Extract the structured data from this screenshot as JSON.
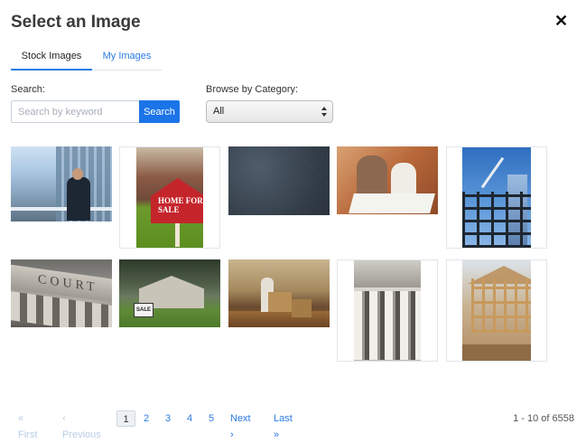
{
  "dialog": {
    "title": "Select an Image",
    "close_glyph": "✕"
  },
  "tabs": [
    {
      "label": "Stock Images",
      "active": true
    },
    {
      "label": "My Images",
      "active": false
    }
  ],
  "search": {
    "label": "Search:",
    "placeholder": "Search by keyword",
    "value": "",
    "button_label": "Search"
  },
  "category": {
    "label": "Browse by Category:",
    "selected": "All"
  },
  "images": [
    {
      "subject": "businessman-balcony"
    },
    {
      "subject": "home-for-sale-sign",
      "caption": "HOME FOR SALE"
    },
    {
      "subject": "dark-texture"
    },
    {
      "subject": "couple-blueprints"
    },
    {
      "subject": "steel-construction"
    },
    {
      "subject": "courthouse",
      "caption": "COURT"
    },
    {
      "subject": "house-sale-sign",
      "caption": "SALE"
    },
    {
      "subject": "moving-boxes"
    },
    {
      "subject": "courthouse-columns"
    },
    {
      "subject": "wood-framing"
    }
  ],
  "pagination": {
    "first": "« First",
    "previous": "‹ Previous",
    "pages": [
      "1",
      "2",
      "3",
      "4",
      "5"
    ],
    "current": "1",
    "next": "Next ›",
    "last": "Last »",
    "range_text": "1 - 10 of 6558"
  },
  "colors": {
    "accent": "#1b74e8",
    "link": "#2a7be4",
    "disabled_link": "#b9cde6"
  }
}
